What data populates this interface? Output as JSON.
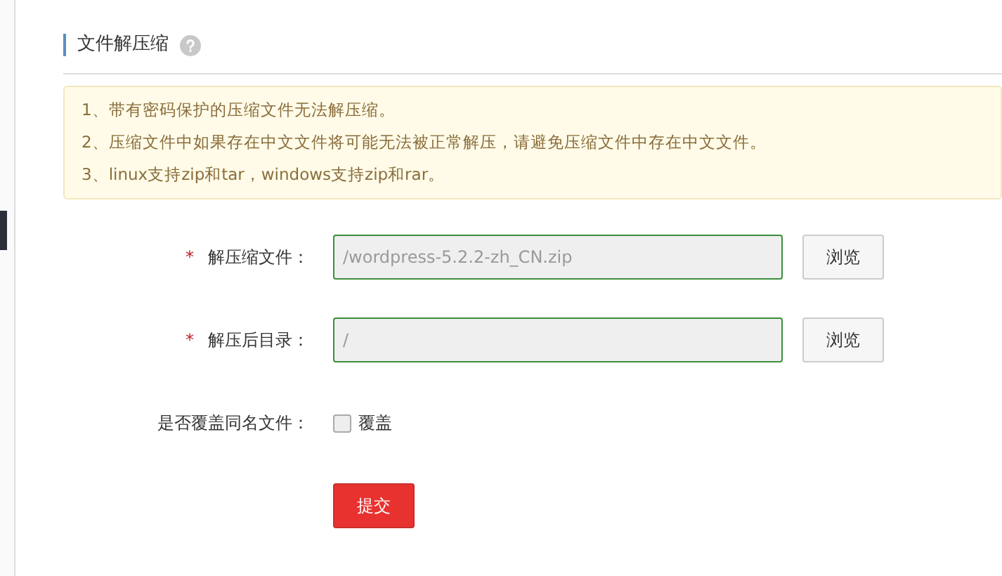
{
  "title": "文件解压缩",
  "notice": [
    "1、带有密码保护的压缩文件无法解压缩。",
    "2、压缩文件中如果存在中文文件将可能无法被正常解压，请避免压缩文件中存在中文文件。",
    "3、linux支持zip和tar，windows支持zip和rar。"
  ],
  "fields": [
    {
      "label": "解压缩文件：",
      "required_mark": "*",
      "value": "/wordpress-5.2.2-zh_CN.zip",
      "button": "浏览"
    },
    {
      "label": "解压后目录：",
      "required_mark": "*",
      "value": "/",
      "button": "浏览"
    }
  ],
  "overwrite": {
    "label": "是否覆盖同名文件：",
    "option": "覆盖",
    "checked": false
  },
  "submit": "提交"
}
